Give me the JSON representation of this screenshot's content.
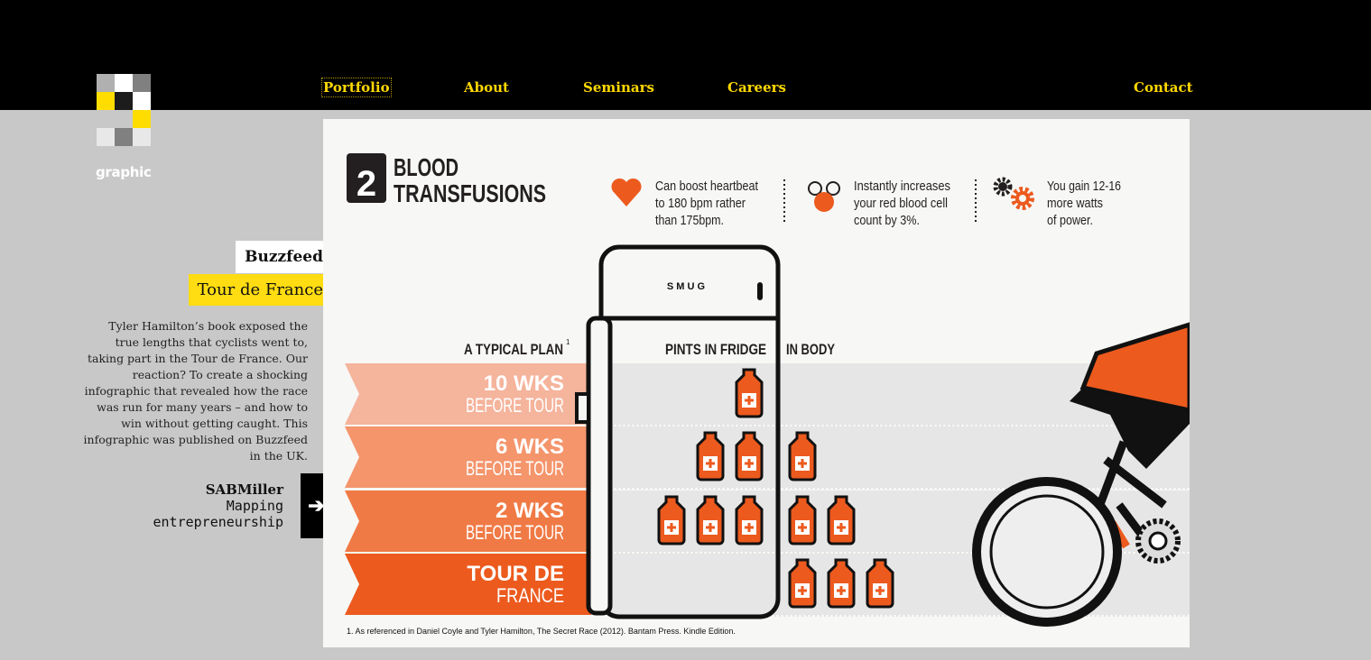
{
  "brand": {
    "name": "graphic",
    "logo_colors": [
      "#b0b0b0",
      "#ffffff",
      "#808080",
      "#ffdd00",
      "#1c1c1c",
      "#ffffff",
      "#c8c8c8",
      "#c8c8c8",
      "#ffdd00",
      "#e8e8e8",
      "#808080",
      "#e8e8e8"
    ]
  },
  "nav": {
    "items": [
      {
        "label": "Portfolio",
        "active": true
      },
      {
        "label": "About"
      },
      {
        "label": "Seminars"
      },
      {
        "label": "Careers"
      },
      {
        "label": "Contact"
      }
    ]
  },
  "project": {
    "client": "Buzzfeed",
    "title": "Tour de France",
    "description": "Tyler Hamilton’s book exposed the true lengths that cyclists went to, taking part in the Tour de France. Our reaction? To create a shocking infographic that revealed how the race was run for many years – and how to win without getting caught. This infographic was published on Buzzfeed in the UK."
  },
  "next": {
    "client": "SABMiller",
    "title_line1": "Mapping",
    "title_line2": "entrepreneurship",
    "icon": "arrow-right-icon"
  },
  "infographic": {
    "number": "2",
    "title_line1": "BLOOD",
    "title_line2": "TRANSFUSIONS",
    "facts": [
      {
        "icon": "heart-icon",
        "lines": [
          "Can boost heartbeat",
          "to 180 bpm rather",
          "than 175bpm."
        ]
      },
      {
        "icon": "blood-cell-icon",
        "lines": [
          "Instantly increases",
          "your red blood cell",
          "count by 3%."
        ]
      },
      {
        "icon": "gears-icon",
        "lines": [
          "You gain 12-16",
          "more watts",
          "of power."
        ]
      }
    ],
    "fridge_brand": "S M U G",
    "headers": {
      "plan": "A TYPICAL PLAN",
      "plan_note": "1",
      "fridge": "PINTS IN FRIDGE",
      "body": "IN BODY"
    },
    "rows": [
      {
        "line1": "10 WKS",
        "line2": "BEFORE TOUR",
        "fridge": 1,
        "body": 0,
        "color": "#f5b49c"
      },
      {
        "line1": "6 WKS",
        "line2": "BEFORE TOUR",
        "fridge": 2,
        "body": 1,
        "color": "#f4956c"
      },
      {
        "line1": "2 WKS",
        "line2": "BEFORE TOUR",
        "fridge": 3,
        "body": 2,
        "color": "#f07a45"
      },
      {
        "line1": "TOUR DE",
        "line2": "FRANCE",
        "fridge": 0,
        "body": 3,
        "color": "#ec5a1e"
      }
    ],
    "footnote": "1. As referenced in Daniel Coyle and Tyler Hamilton, The Secret Race  (2012). Bantam Press. Kindle Edition.",
    "accent": "#ec5a1e"
  }
}
